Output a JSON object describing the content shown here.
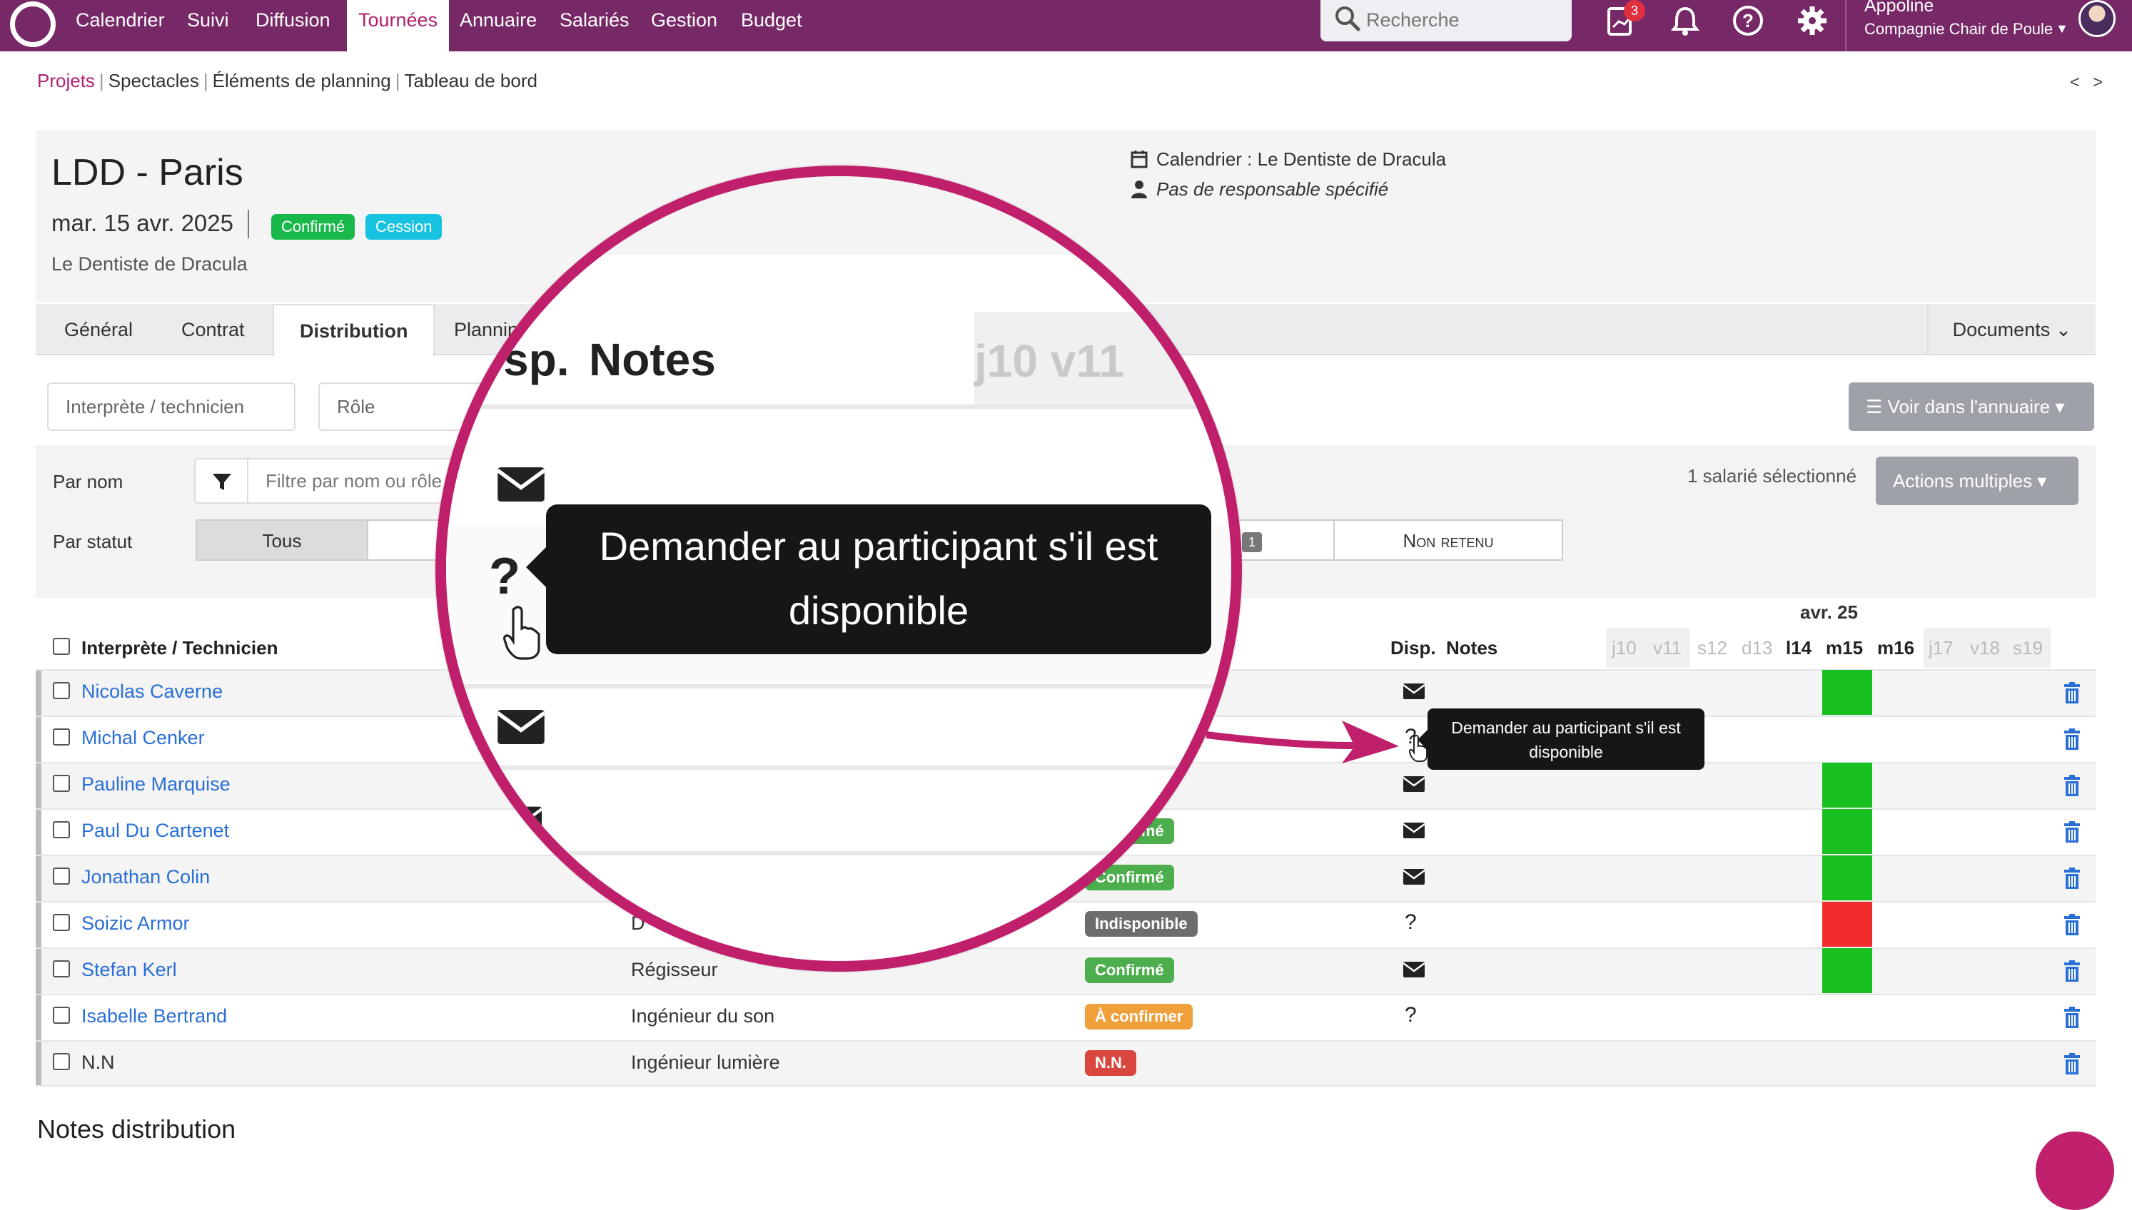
{
  "nav": {
    "items": [
      "Calendrier",
      "Suivi",
      "Diffusion",
      "Tournées",
      "Annuaire",
      "Salariés",
      "Gestion",
      "Budget"
    ],
    "active": "Tournées",
    "search_placeholder": "Recherche",
    "notif_count": "3",
    "user_name": "Appoline",
    "company": "Compagnie Chair de Poule"
  },
  "breadcrumb": [
    "Projets",
    "Spectacles",
    "Éléments de planning",
    "Tableau de bord"
  ],
  "project": {
    "title": "LDD - Paris",
    "date": "mar. 15 avr. 2025",
    "badge_confirmed": "Confirmé",
    "badge_cession": "Cession",
    "subtitle": "Le Dentiste de Dracula",
    "calendar": "Calendrier : Le Dentiste de Dracula",
    "manager": "Pas de responsable spécifié"
  },
  "tabs": [
    "Général",
    "Contrat",
    "Distribution",
    "Planning"
  ],
  "documents_label": "Documents",
  "filters": {
    "interprete_placeholder": "Interprète / technicien",
    "role_placeholder": "Rôle",
    "voir_annuaire": "Voir dans l'annuaire",
    "par_nom": "Par nom",
    "name_filter_placeholder": "Filtre par nom ou rôle",
    "par_statut": "Par statut",
    "status_all": "Tous",
    "status_count": "1",
    "status_non_retenu": "Non retenu",
    "selected_count": "1 salarié sélectionné",
    "actions_multiples": "Actions multiples"
  },
  "table": {
    "month_label": "avr. 25",
    "col_name": "Interprète / Technicien",
    "col_disp": "Disp.",
    "col_notes": "Notes",
    "days": [
      "j10",
      "v11",
      "s12",
      "d13",
      "l14",
      "m15",
      "m16",
      "j17",
      "v18",
      "s19"
    ],
    "rows": [
      {
        "name": "Nicolas Caverne",
        "role": "",
        "status": "",
        "disp": "mail",
        "day": "green"
      },
      {
        "name": "Michal Cenker",
        "role": "",
        "status": "",
        "disp": "?",
        "day": ""
      },
      {
        "name": "Pauline Marquise",
        "role": "",
        "status": "",
        "disp": "mail",
        "day": "green"
      },
      {
        "name": "Paul Du Cartenet",
        "role": "",
        "status": "Confirmé",
        "disp": "mail",
        "day": "green"
      },
      {
        "name": "Jonathan Colin",
        "role": "",
        "status": "Confirmé",
        "disp": "mail",
        "day": "green"
      },
      {
        "name": "Soizic Armor",
        "role": "D",
        "status": "Indisponible",
        "disp": "?",
        "day": "red"
      },
      {
        "name": "Stefan Kerl",
        "role": "Régisseur",
        "status": "Confirmé",
        "disp": "mail",
        "day": "green"
      },
      {
        "name": "Isabelle Bertrand",
        "role": "Ingénieur du son",
        "status": "À confirmer",
        "disp": "?",
        "day": ""
      },
      {
        "name": "N.N",
        "role": "Ingénieur lumière",
        "status": "N.N.",
        "disp": "",
        "day": ""
      }
    ]
  },
  "tooltip": "Demander au participant s'il est disponible",
  "magnifier": {
    "disp": "sp.",
    "notes": "Notes",
    "days": "j10  v11",
    "question": "?"
  },
  "notes_title": "Notes distribution",
  "colors": {
    "brand": "#772866",
    "accent": "#c0206b",
    "confirmed": "#4cae4c",
    "cession": "#17c3e0",
    "unavailable": "#6d6d6d",
    "to_confirm": "#f0a03a",
    "nn": "#d9463d",
    "link": "#2a6fd6"
  }
}
